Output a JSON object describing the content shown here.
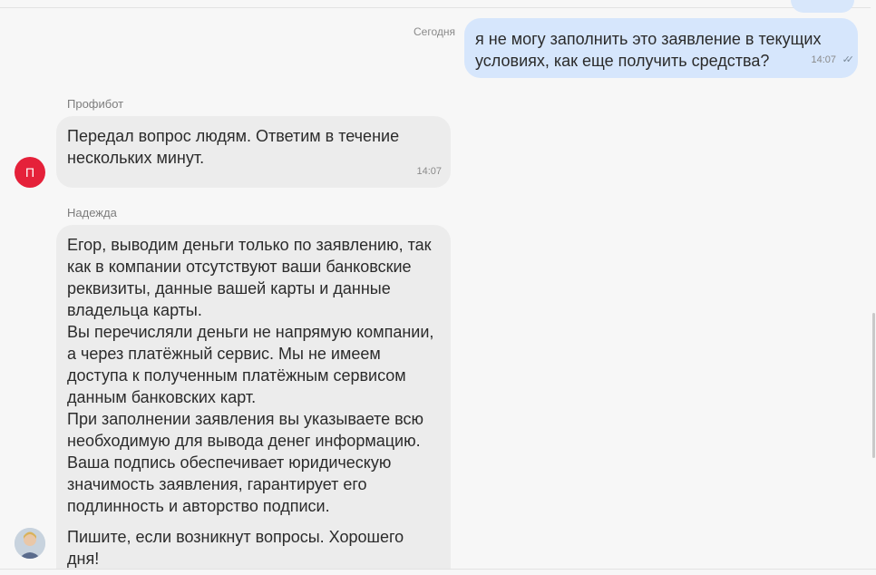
{
  "date_label": "Сегодня",
  "messages": [
    {
      "direction": "outgoing",
      "text": "я не могу заполнить это заявление в текущих условиях, как еще получить средства?",
      "time": "14:07",
      "status": "read"
    },
    {
      "direction": "incoming",
      "sender": "Профибот",
      "avatar_letter": "П",
      "text": "Передал вопрос людям. Ответим в течение нескольких минут.",
      "time": "14:07"
    },
    {
      "direction": "incoming",
      "sender": "Надежда",
      "paragraphs": [
        "Егор, выводим деньги только по заявлению, так как в компании отсутствуют ваши банковские реквизиты, данные вашей карты и данные владельца карты.\nВы перечисляли деньги не напрямую компании, а через платёжный сервис. Мы не имеем доступа к полученным платёжным сервисом данным банковских карт.\nПри заполнении заявления вы указываете всю необходимую для вывода денег информацию. Ваша подпись обеспечивает юридическую значимость заявления, гарантирует его подлинность и авторство подписи.",
        "Пишите, если возникнут вопросы. Хорошего дня!"
      ]
    }
  ],
  "colors": {
    "outgoing_bubble": "#d6e6fc",
    "incoming_bubble": "#ececec",
    "bot_avatar": "#e5213a"
  },
  "icons": {
    "read_status": "double-check-icon"
  }
}
